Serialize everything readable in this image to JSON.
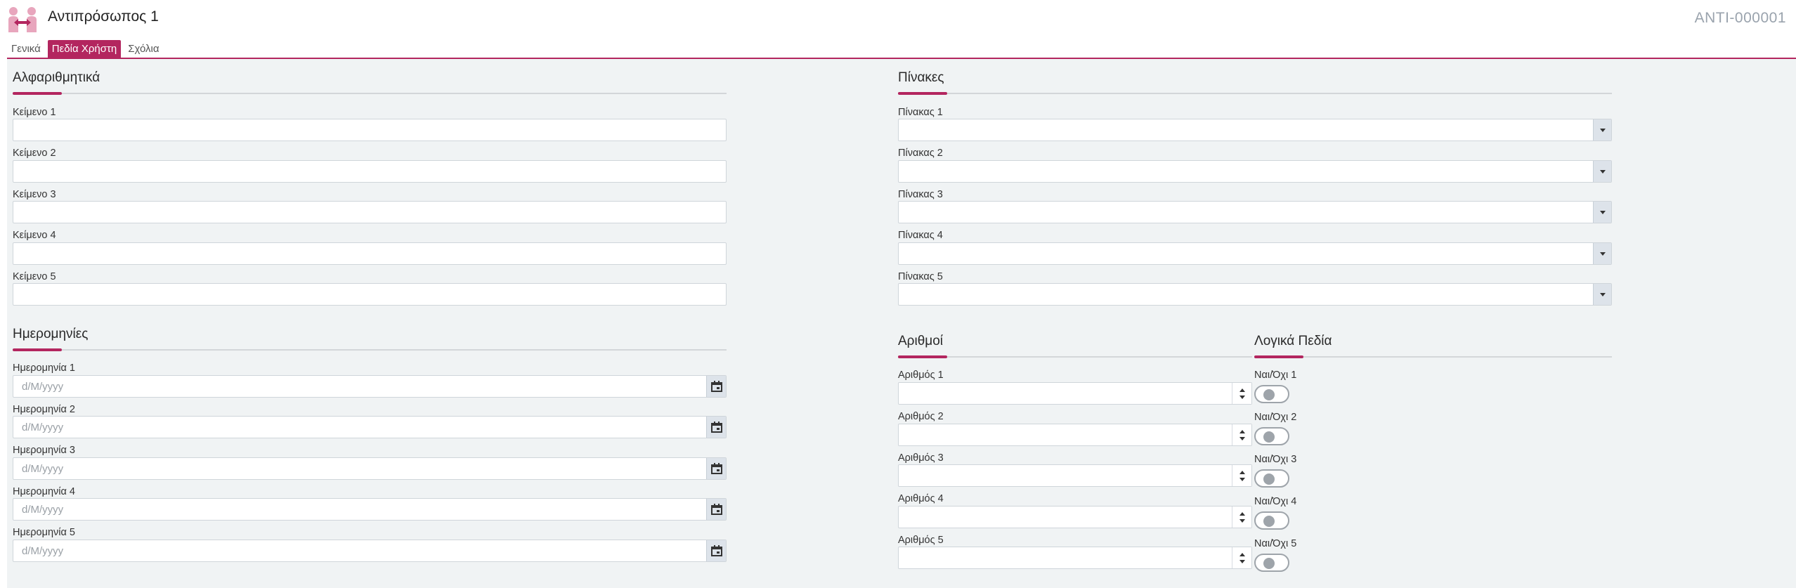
{
  "header": {
    "title": "Αντιπρόσωπος 1",
    "record_code": "ANTI-000001",
    "icon": "handshake-icon"
  },
  "tabs": [
    {
      "label": "Γενικά",
      "active": false
    },
    {
      "label": "Πεδία Χρήστη",
      "active": true
    },
    {
      "label": "Σχόλια",
      "active": false
    }
  ],
  "colors": {
    "accent": "#b3265f",
    "background": "#f0f3f4"
  },
  "alphanumeric": {
    "title": "Αλφαριθμητικά",
    "fields": [
      {
        "label": "Κείμενο 1",
        "value": ""
      },
      {
        "label": "Κείμενο 2",
        "value": ""
      },
      {
        "label": "Κείμενο 3",
        "value": ""
      },
      {
        "label": "Κείμενο 4",
        "value": ""
      },
      {
        "label": "Κείμενο 5",
        "value": ""
      }
    ]
  },
  "tables": {
    "title": "Πίνακες",
    "fields": [
      {
        "label": "Πίνακας 1",
        "value": ""
      },
      {
        "label": "Πίνακας 2",
        "value": ""
      },
      {
        "label": "Πίνακας 3",
        "value": ""
      },
      {
        "label": "Πίνακας 4",
        "value": ""
      },
      {
        "label": "Πίνακας 5",
        "value": ""
      }
    ]
  },
  "dates": {
    "title": "Ημερομηνίες",
    "fields": [
      {
        "label": "Ημερομηνία 1",
        "placeholder": "d/M/yyyy"
      },
      {
        "label": "Ημερομηνία 2",
        "placeholder": "d/M/yyyy"
      },
      {
        "label": "Ημερομηνία 3",
        "placeholder": "d/M/yyyy"
      },
      {
        "label": "Ημερομηνία 4",
        "placeholder": "d/M/yyyy"
      },
      {
        "label": "Ημερομηνία 5",
        "placeholder": "d/M/yyyy"
      }
    ]
  },
  "numbers": {
    "title": "Αριθμοί",
    "fields": [
      {
        "label": "Αριθμός 1",
        "value": ""
      },
      {
        "label": "Αριθμός 2",
        "value": ""
      },
      {
        "label": "Αριθμός 3",
        "value": ""
      },
      {
        "label": "Αριθμός 4",
        "value": ""
      },
      {
        "label": "Αριθμός 5",
        "value": ""
      }
    ]
  },
  "booleans": {
    "title": "Λογικά Πεδία",
    "fields": [
      {
        "label": "Ναι/Όχι 1",
        "checked": false
      },
      {
        "label": "Ναι/Όχι 2",
        "checked": false
      },
      {
        "label": "Ναι/Όχι 3",
        "checked": false
      },
      {
        "label": "Ναι/Όχι 4",
        "checked": false
      },
      {
        "label": "Ναι/Όχι 5",
        "checked": false
      }
    ]
  }
}
